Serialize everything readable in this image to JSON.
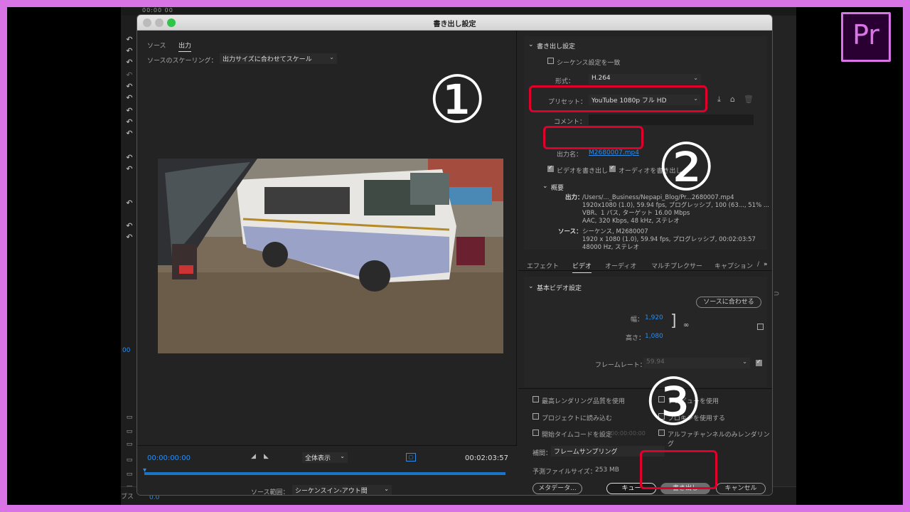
{
  "background_app": {
    "timecode": "00:00 00",
    "bottom_label": "ブス",
    "bottom_value": "0.0",
    "left_mark": "00"
  },
  "window": {
    "title": "書き出し設定"
  },
  "left_pane": {
    "tabs": [
      "ソース",
      "出力"
    ],
    "active_tab": "出力",
    "scaling_label": "ソースのスケーリング：",
    "scaling_value": "出力サイズに合わせてスケール",
    "timecode_in": "00:00:00:00",
    "timecode_out": "00:02:03:57",
    "zoom_value": "全体表示",
    "source_range_label": "ソース範囲：",
    "source_range_value": "シーケンスイン-アウト間"
  },
  "export_settings": {
    "section_title": "書き出し設定",
    "match_sequence_label": "シーケンス設定を一致",
    "format_label": "形式：",
    "format_value": "H.264",
    "preset_label": "プリセット：",
    "preset_value": "YouTube 1080p フル HD",
    "comment_label": "コメント：",
    "comment_value": "",
    "output_name_label": "出力名：",
    "output_name_value": "M2680007.mp4",
    "export_video_label": "ビデオを書き出し",
    "export_audio_label": "オーディオを書き出し",
    "summary_title": "概要",
    "summary_output_label": "出力：",
    "summary_output_lines": [
      "/Users/..._Business/Nepapi_Blog/Pr...2680007.mp4",
      "1920x1080 (1.0), 59.94 fps, プログレッシブ, 100 (63..., 51% ...",
      "VBR、1 パス, ターゲット 16.00 Mbps",
      "AAC, 320 Kbps, 48 kHz, ステレオ"
    ],
    "summary_source_label": "ソース：",
    "summary_source_lines": [
      "シーケンス, M2680007",
      "1920 x 1080 (1.0), 59.94 fps, プログレッシブ, 00:02:03:57",
      "48000 Hz, ステレオ"
    ]
  },
  "settings_tabs": [
    "エフェクト",
    "ビデオ",
    "オーディオ",
    "マルチプレクサー",
    "キャプション",
    "/"
  ],
  "active_settings_tab": "ビデオ",
  "video_settings": {
    "section_title": "基本ビデオ設定",
    "match_source_button": "ソースに合わせる",
    "width_label": "幅：",
    "width_value": "1,920",
    "height_label": "高さ：",
    "height_value": "1,080",
    "framerate_label": "フレームレート：",
    "framerate_value": "59.94"
  },
  "bottom_options": {
    "max_render_quality": "最高レンダリング品質を使用",
    "use_previews": "プレビューを使用",
    "import_into_project": "プロジェクトに読み込む",
    "use_proxies": "プロキシを使用する",
    "set_start_timecode": "開始タイムコードを設定",
    "start_timecode_value": "00:00:00:00",
    "alpha_only": "アルファチャンネルのみレンダリング",
    "interpolation_label": "補間：",
    "interpolation_value": "フレームサンプリング",
    "estimated_size_label": "予測ファイルサイズ：",
    "estimated_size_value": "253 MB"
  },
  "buttons": {
    "metadata": "メタデータ...",
    "queue": "キュー",
    "export": "書き出し",
    "cancel": "キャンセル"
  },
  "annotations": {
    "step1": "①",
    "step2": "②",
    "step3": "③",
    "accent_color": "#e0002b"
  },
  "logo": {
    "text": "Pr"
  }
}
